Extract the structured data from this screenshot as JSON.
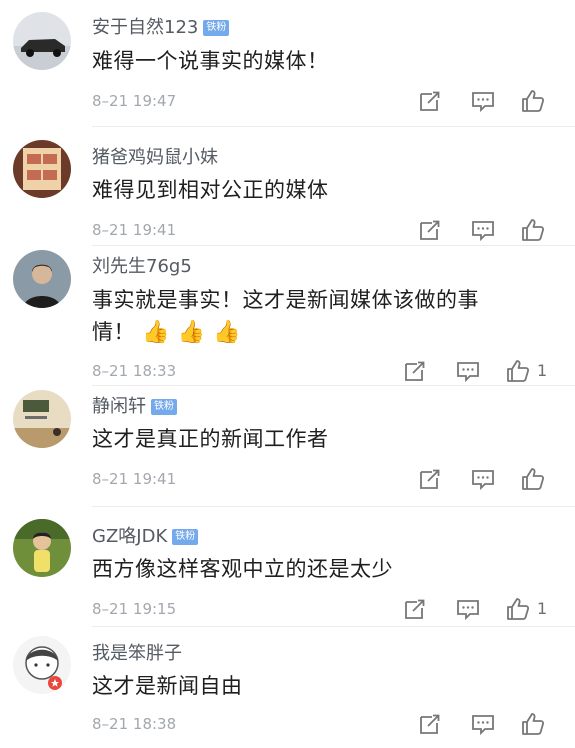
{
  "comments": [
    {
      "username": "安于自然123",
      "badge": "铁粉",
      "text": "难得一个说事实的媒体！",
      "timestamp": "8–21 19:47",
      "likes": ""
    },
    {
      "username": "猪爸鸡妈鼠小妹",
      "badge": "",
      "text": "难得见到相对公正的媒体",
      "timestamp": "8–21 19:41",
      "likes": ""
    },
    {
      "username": "刘先生76g5",
      "badge": "",
      "text_line1": "事实就是事实！这才是新闻媒体该做的事",
      "text_line2": "情！",
      "emoji": "👍 👍 👍",
      "timestamp": "8–21 18:33",
      "likes": "1"
    },
    {
      "username": "静闲轩",
      "badge": "铁粉",
      "text": "这才是真正的新闻工作者",
      "timestamp": "8–21 19:41",
      "likes": ""
    },
    {
      "username": "GZ咯JDK",
      "badge": "铁粉",
      "text": "西方像这样客观中立的还是太少",
      "timestamp": "8–21 19:15",
      "likes": "1"
    },
    {
      "username": "我是笨胖子",
      "badge": "",
      "text": "这才是新闻自由",
      "timestamp": "8–21 18:38",
      "likes": ""
    }
  ],
  "icons": {
    "repost": "repost-icon",
    "reply": "comment-icon",
    "like": "thumbs-up-icon"
  },
  "colors": {
    "badge": "#74a9ec",
    "username": "#555b63",
    "timestamp": "#a3a8ae"
  }
}
